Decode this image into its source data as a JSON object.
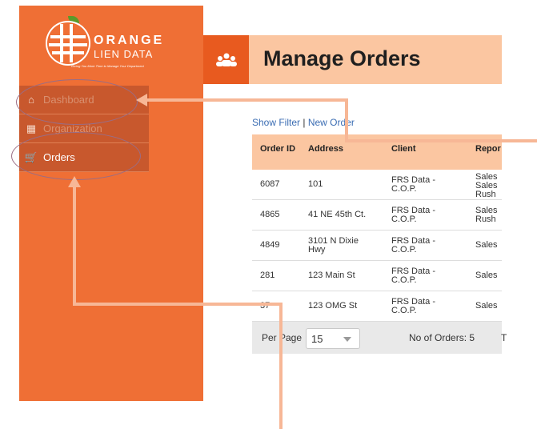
{
  "logo": {
    "brand_line1": "ORANGE",
    "brand_line2": "LIEN DATA",
    "tagline": "Giving You More Time to Manage Your Department"
  },
  "sidebar": {
    "items": [
      {
        "label": "Dashboard",
        "icon": "home-icon"
      },
      {
        "label": "Organization",
        "icon": "building-icon"
      },
      {
        "label": "Orders",
        "icon": "cart-icon"
      }
    ]
  },
  "header": {
    "title": "Manage Orders",
    "icon": "users-icon"
  },
  "links": {
    "show_filter": "Show Filter",
    "separator": "|",
    "new_order": "New Order"
  },
  "table": {
    "columns": [
      "Order ID",
      "Address",
      "Client",
      "Repor"
    ],
    "rows": [
      {
        "id": "6087",
        "address": "101",
        "client": "FRS Data - C.O.P.",
        "report": "Sales Sales Rush"
      },
      {
        "id": "4865",
        "address": "41 NE 45th Ct.",
        "client": "FRS Data - C.O.P.",
        "report": "Sales Rush"
      },
      {
        "id": "4849",
        "address": "3101 N Dixie Hwy",
        "client": "FRS Data - C.O.P.",
        "report": "Sales"
      },
      {
        "id": "281",
        "address": "123 Main St",
        "client": "FRS Data - C.O.P.",
        "report": "Sales"
      },
      {
        "id": "37",
        "address": "123 OMG St",
        "client": "FRS Data - C.O.P.",
        "report": "Sales"
      }
    ]
  },
  "footer": {
    "per_page_label": "Per Page",
    "per_page_value": "15",
    "order_count": "No of Orders: 5",
    "truncated": "T"
  },
  "colors": {
    "sidebar": "#ef6f35",
    "header_bar": "#fbc6a1",
    "header_icon": "#e85a1f",
    "annotation": "#f7b796"
  }
}
